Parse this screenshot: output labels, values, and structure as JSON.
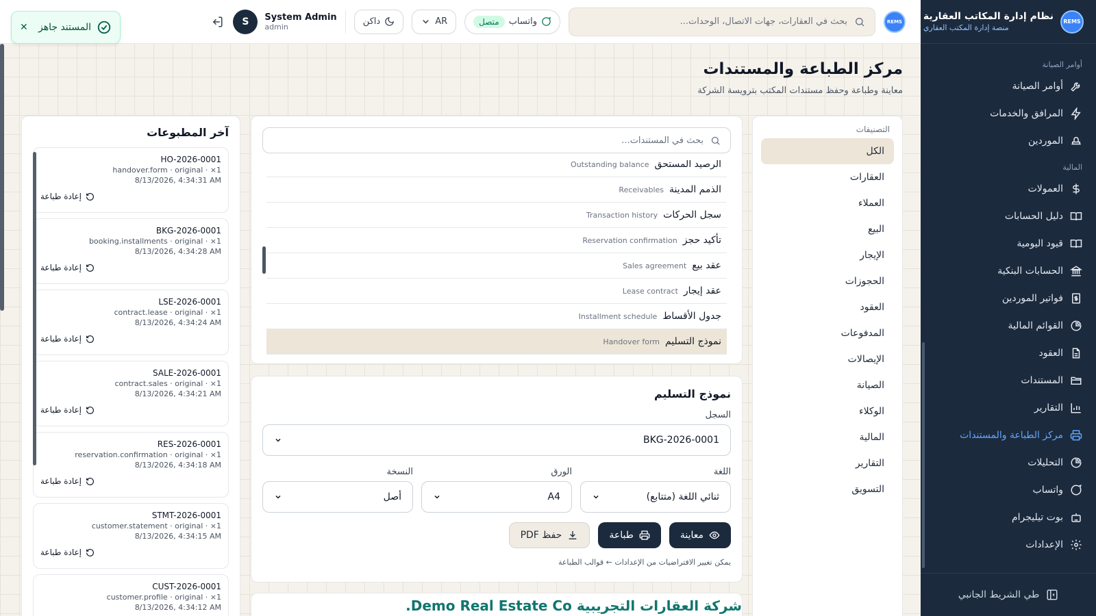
{
  "brand": {
    "title": "نظام إدارة المكاتب العقارية",
    "subtitle": "منصة إدارة المكتب العقاري",
    "logo": "REMS"
  },
  "sidebar": {
    "sections": [
      {
        "label": "أوامر الصيانة",
        "items": [
          {
            "label": "أوامر الصيانة",
            "icon": "wrench-icon"
          },
          {
            "label": "المرافق والخدمات",
            "icon": "bolt-icon"
          },
          {
            "label": "الموردين",
            "icon": "supplier-icon"
          }
        ]
      },
      {
        "label": "المالية",
        "items": [
          {
            "label": "العمولات",
            "icon": "dollar-icon"
          },
          {
            "label": "دليل الحسابات",
            "icon": "book-icon"
          },
          {
            "label": "قيود اليومية",
            "icon": "book-icon"
          },
          {
            "label": "الحسابات البنكية",
            "icon": "bank-icon"
          },
          {
            "label": "فواتير الموردين",
            "icon": "invoice-icon"
          },
          {
            "label": "القوائم المالية",
            "icon": "pie-icon"
          },
          {
            "label": "العقود",
            "icon": "file-icon"
          },
          {
            "label": "المستندات",
            "icon": "folder-icon"
          },
          {
            "label": "التقارير",
            "icon": "chart-icon"
          },
          {
            "label": "مركز الطباعة والمستندات",
            "icon": "printer-icon",
            "active": true
          },
          {
            "label": "التحليلات",
            "icon": "pie-icon"
          },
          {
            "label": "واتساب",
            "icon": "chat-icon"
          },
          {
            "label": "بوت تيليجرام",
            "icon": "bot-icon"
          },
          {
            "label": "الإعدادات",
            "icon": "gear-icon"
          }
        ]
      }
    ],
    "collapse_label": "طي الشريط الجانبي"
  },
  "topbar": {
    "search_placeholder": "بحث في العقارات، جهات الاتصال، الوحدات...",
    "whatsapp_label": "واتساب",
    "whatsapp_status": "متصل",
    "language": "AR",
    "theme_label": "داكن",
    "user_name": "System Admin",
    "user_role": "admin",
    "user_initial": "S"
  },
  "toast": {
    "message": "المستند جاهز"
  },
  "page": {
    "title": "مركز الطباعة والمستندات",
    "subtitle": "معاينة وطباعة وحفظ مستندات المكتب بترويسة الشركة"
  },
  "categories": {
    "title": "التصنيفات",
    "items": [
      "الكل",
      "العقارات",
      "العملاء",
      "البيع",
      "الإيجار",
      "الحجوزات",
      "العقود",
      "المدفوعات",
      "الإيصالات",
      "الصيانة",
      "الوكلاء",
      "المالية",
      "التقارير",
      "التسويق"
    ],
    "active": 0
  },
  "documents": {
    "search_placeholder": "بحث في المستندات...",
    "items": [
      {
        "ar": "الرصيد المستحق",
        "en": "Outstanding balance"
      },
      {
        "ar": "الذمم المدينة",
        "en": "Receivables"
      },
      {
        "ar": "سجل الحركات",
        "en": "Transaction history"
      },
      {
        "ar": "تأكيد حجز",
        "en": "Reservation confirmation"
      },
      {
        "ar": "عقد بيع",
        "en": "Sales agreement"
      },
      {
        "ar": "عقد إيجار",
        "en": "Lease contract"
      },
      {
        "ar": "جدول الأقساط",
        "en": "Installment schedule"
      },
      {
        "ar": "نموذج التسليم",
        "en": "Handover form",
        "active": true
      }
    ]
  },
  "form": {
    "title": "نموذج التسليم",
    "record_label": "السجل",
    "record_value": "BKG-2026-0001",
    "language_label": "اللغة",
    "language_value": "ثنائي اللغة (متتابع)",
    "paper_label": "الورق",
    "paper_value": "A4",
    "copy_label": "النسخة",
    "copy_value": "أصل",
    "preview_btn": "معاينة",
    "print_btn": "طباعة",
    "pdf_btn": "حفظ PDF",
    "hint": "يمكن تغيير الافتراضيات من الإعدادات ← قوالب الطباعة"
  },
  "preview": {
    "company": "شركة العقارات التجريبية Demo Real Estate Co."
  },
  "recent": {
    "title": "آخر المطبوعات",
    "reprint_label": "إعادة طباعة",
    "items": [
      {
        "code": "HO-2026-0001",
        "meta": "handover.form · original · ×1",
        "time": "8/13/2026, 4:34:31 AM"
      },
      {
        "code": "BKG-2026-0001",
        "meta": "booking.installments · original · ×1",
        "time": "8/13/2026, 4:34:28 AM"
      },
      {
        "code": "LSE-2026-0001",
        "meta": "contract.lease · original · ×1",
        "time": "8/13/2026, 4:34:24 AM"
      },
      {
        "code": "SALE-2026-0001",
        "meta": "contract.sales · original · ×1",
        "time": "8/13/2026, 4:34:21 AM"
      },
      {
        "code": "RES-2026-0001",
        "meta": "reservation.confirmation · original · ×1",
        "time": "8/13/2026, 4:34:18 AM"
      },
      {
        "code": "STMT-2026-0001",
        "meta": "customer.statement · original · ×1",
        "time": "8/13/2026, 4:34:15 AM"
      },
      {
        "code": "CUST-2026-0001",
        "meta": "customer.profile · original · ×1",
        "time": "8/13/2026, 4:34:12 AM"
      }
    ]
  },
  "colors": {
    "sidebar_bg": "#1c2a3d",
    "accent": "#60a5fa",
    "selected_bg": "#ede5d7",
    "success": "#047857",
    "preview_title": "#0f766e"
  }
}
